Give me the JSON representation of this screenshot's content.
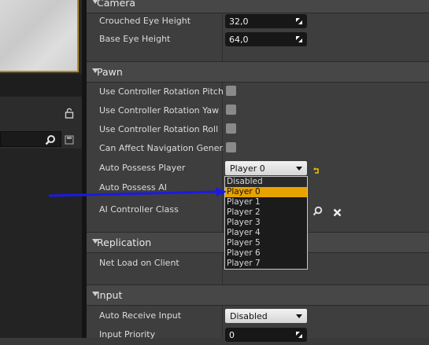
{
  "viewport": {
    "border_color": "#b88a1a"
  },
  "sections": {
    "camera": "Camera",
    "pawn": "Pawn",
    "replication": "Replication",
    "input": "Input"
  },
  "camera": {
    "crouched_eye_height_label": "Crouched Eye Height",
    "crouched_eye_height_value": "32,0",
    "base_eye_height_label": "Base Eye Height",
    "base_eye_height_value": "64,0"
  },
  "pawn": {
    "rotation_pitch_label": "Use Controller Rotation Pitch",
    "rotation_yaw_label": "Use Controller Rotation Yaw",
    "rotation_roll_label": "Use Controller Rotation Roll",
    "affect_nav_label": "Can Affect Navigation Generation",
    "auto_possess_player_label": "Auto Possess Player",
    "auto_possess_player_value": "Player 0",
    "auto_possess_ai_label": "Auto Possess AI",
    "ai_controller_label": "AI Controller Class"
  },
  "dropdown": {
    "options": [
      "Disabled",
      "Player 0",
      "Player 1",
      "Player 2",
      "Player 3",
      "Player 4",
      "Player 5",
      "Player 6",
      "Player 7"
    ],
    "selected": "Player 0"
  },
  "replication": {
    "net_load_label": "Net Load on Client"
  },
  "input": {
    "auto_receive_label": "Auto Receive Input",
    "auto_receive_value": "Disabled",
    "priority_label": "Input Priority",
    "priority_value": "0"
  },
  "colors": {
    "accent": "#e7a300",
    "arrow": "#1a1ae6"
  },
  "icons": [
    "lock-icon",
    "search-icon",
    "save-icon",
    "reset-arrow-icon",
    "browse-search-icon",
    "clear-x-icon",
    "numeric-drag-arrows-icon",
    "collapse-triangle-icon"
  ]
}
